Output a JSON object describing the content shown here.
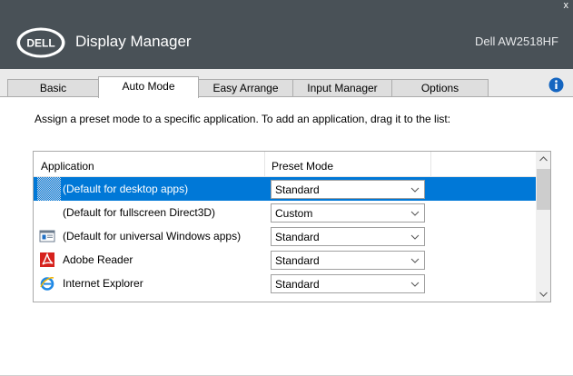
{
  "window": {
    "app_title": "Display Manager",
    "monitor_name": "Dell AW2518HF",
    "close_symbol": "x",
    "logo_text": "DELL"
  },
  "tabs": [
    {
      "label": "Basic",
      "active": false
    },
    {
      "label": "Auto Mode",
      "active": true
    },
    {
      "label": "Easy Arrange",
      "active": false
    },
    {
      "label": "Input Manager",
      "active": false
    },
    {
      "label": "Options",
      "active": false
    }
  ],
  "info_icon": "info-icon",
  "instructions": "Assign a preset mode to a specific application.  To add an application, drag it to the list:",
  "list": {
    "columns": [
      "Application",
      "Preset Mode"
    ],
    "rows": [
      {
        "icon": "desktop-apps-icon",
        "application": "(Default for desktop apps)",
        "preset_mode": "Standard",
        "selected": true
      },
      {
        "icon": "",
        "application": "(Default for fullscreen Direct3D)",
        "preset_mode": "Custom",
        "selected": false
      },
      {
        "icon": "universal-windows-apps-icon",
        "application": "(Default for universal Windows apps)",
        "preset_mode": "Standard",
        "selected": false
      },
      {
        "icon": "adobe-reader-icon",
        "application": "Adobe Reader",
        "preset_mode": "Standard",
        "selected": false
      },
      {
        "icon": "internet-explorer-icon",
        "application": "Internet Explorer",
        "preset_mode": "Standard",
        "selected": false
      }
    ]
  },
  "colors": {
    "titlebar": "#495157",
    "selection": "#0078d7",
    "info_icon": "#1565c0",
    "adobe_red": "#d6221d",
    "ie_blue": "#1e88e5"
  }
}
